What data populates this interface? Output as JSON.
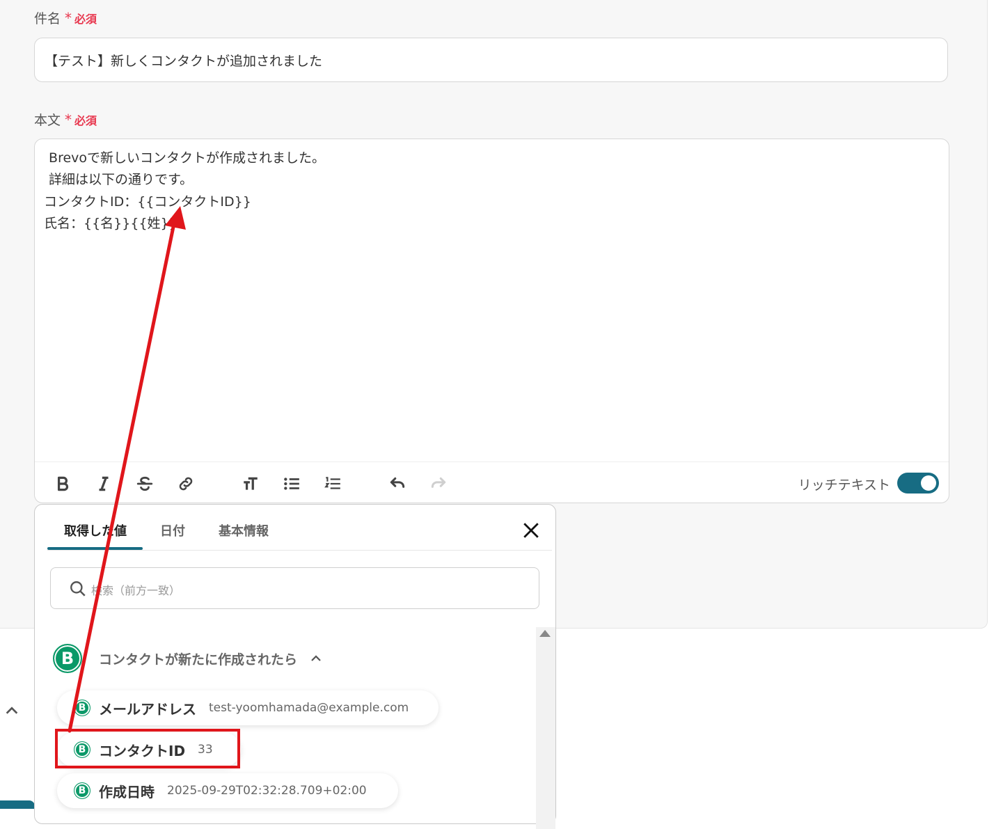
{
  "form": {
    "subject_label": "件名",
    "required_star": "*",
    "required_text": "必須",
    "subject_value": "【テスト】新しくコンタクトが追加されました",
    "body_label": "本文",
    "body_lines": [
      " Brevoで新しいコンタクトが作成されました。",
      " 詳細は以下の通りです。",
      "コンタクトID：{{コンタクトID}}",
      "氏名：{{名}}{{姓}}"
    ],
    "toolbar": {
      "icons": [
        "bold-icon",
        "italic-icon",
        "strikethrough-icon",
        "link-icon",
        "text-size-icon",
        "bulleted-list-icon",
        "numbered-list-icon",
        "undo-icon",
        "redo-icon"
      ],
      "rich_text_label": "リッチテキスト",
      "rich_text_enabled": true
    }
  },
  "popup": {
    "tabs": [
      {
        "label": "取得した値",
        "active": true
      },
      {
        "label": "日付",
        "active": false
      },
      {
        "label": "基本情報",
        "active": false
      }
    ],
    "search_placeholder": "検索（前方一致）",
    "group": {
      "badge": "B",
      "title": "コンタクトが新たに作成されたら"
    },
    "items": [
      {
        "badge": "B",
        "name": "メールアドレス",
        "value": "test-yoomhamada@example.com"
      },
      {
        "badge": "B",
        "name": "コンタクトID",
        "value": "33"
      },
      {
        "badge": "B",
        "name": "作成日時",
        "value": "2025-09-29T02:32:28.709+02:00"
      }
    ]
  },
  "colors": {
    "accent": "#176c83",
    "required": "#e8384f",
    "annotation": "#e0161b",
    "brevo": "#0b9968"
  }
}
